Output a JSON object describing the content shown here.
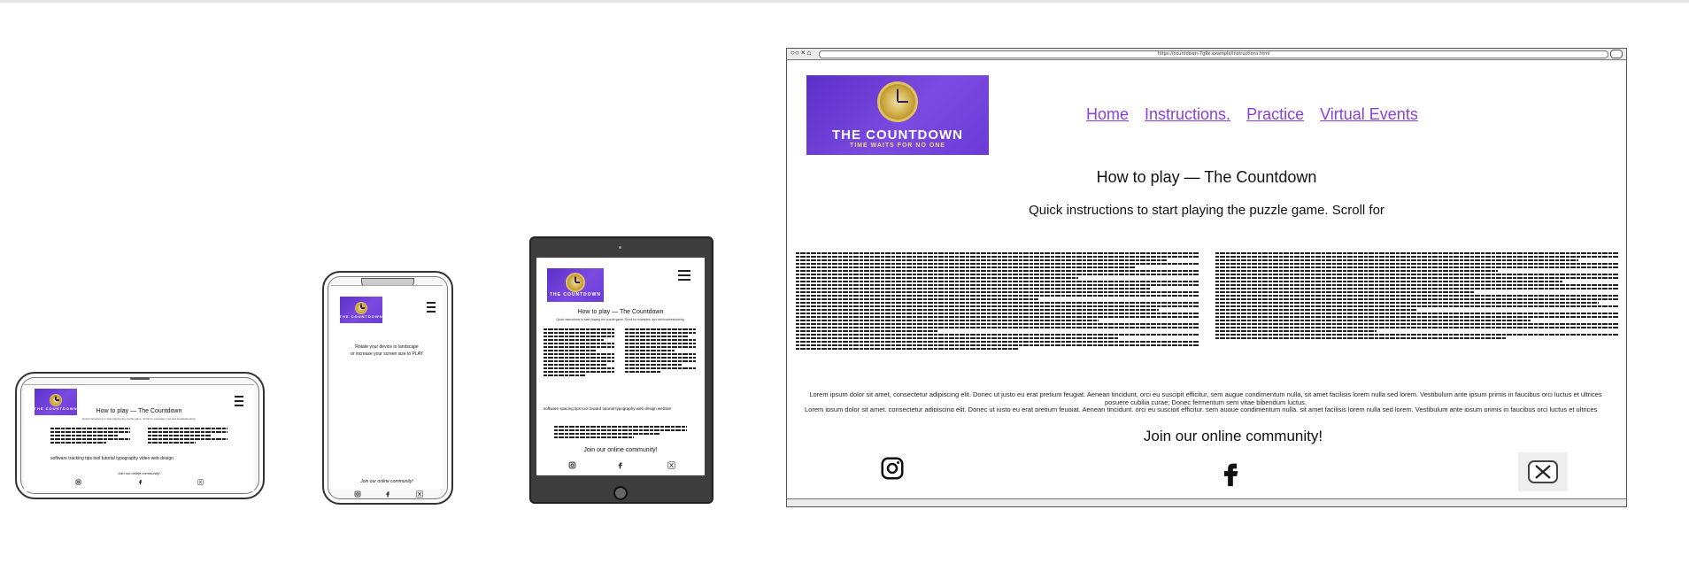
{
  "logo": {
    "line1": "THE COUNTDOWN",
    "line2": "TIME WAITS FOR NO ONE"
  },
  "colors": {
    "nav_link": "#8a3fe0",
    "logo_bg": "#5b2fc9",
    "logo_gold": "#f0d77a"
  },
  "desktop": {
    "url": "https://countdown-7g9x.example/instructions.html",
    "nav": [
      "Home",
      "Instructions.",
      "Practice",
      "Virtual Events"
    ],
    "heading": "How to play — The Countdown",
    "subheading": "Quick instructions to start playing the puzzle game. Scroll for",
    "lorem1": "Lorem ipsum dolor sit amet, consectetur adipiscing elit. Donec ut justo eu erat pretium feugiat. Aenean tincidunt, orci eu suscipit efficitur, sem augue condimentum nulla, sit amet facilisis lorem nulla sed lorem. Vestibulum ante ipsum primis in faucibus orci luctus et ultrices posuere cubilia curae; Donec fermentum sem vitae bibendum luctus.",
    "lorem2": "Lorem ipsum dolor sit amet, consectetur adipiscing elit. Donec ut justo eu erat pretium feugiat. Aenean tincidunt, orci eu suscipit efficitur, sem augue condimentum nulla, sit amet facilisis lorem nulla sed lorem. Vestibulum ante ipsum primis in faucibus orci luctus et ultrices",
    "community": "Join our online community!",
    "social": [
      "instagram-icon",
      "facebook-icon",
      "x-twitter-icon"
    ]
  },
  "tablet": {
    "heading": "How to play — The Countdown",
    "subheading": "Quick instructions to start playing the puzzle game. Scroll for examples, tips and troubleshooting.",
    "tag_cloud": "software  spacing  tips  tool  toward  tutorial  typography  web design  website",
    "community": "Join our online community!"
  },
  "phone_portrait": {
    "message_line1": "Rotate your device to landscape",
    "message_line2": "or increase your screen size to PLAY",
    "community": "Join our online community!"
  },
  "phone_landscape": {
    "heading": "How to play — The Countdown",
    "subheading": "Quick instructions to start playing the puzzle game. Scroll for examples, tips and troubleshooting.",
    "tag_cloud": "software  tracking  tips  tool  tutorial  typography  video  web design",
    "community": "Join our online community!"
  }
}
